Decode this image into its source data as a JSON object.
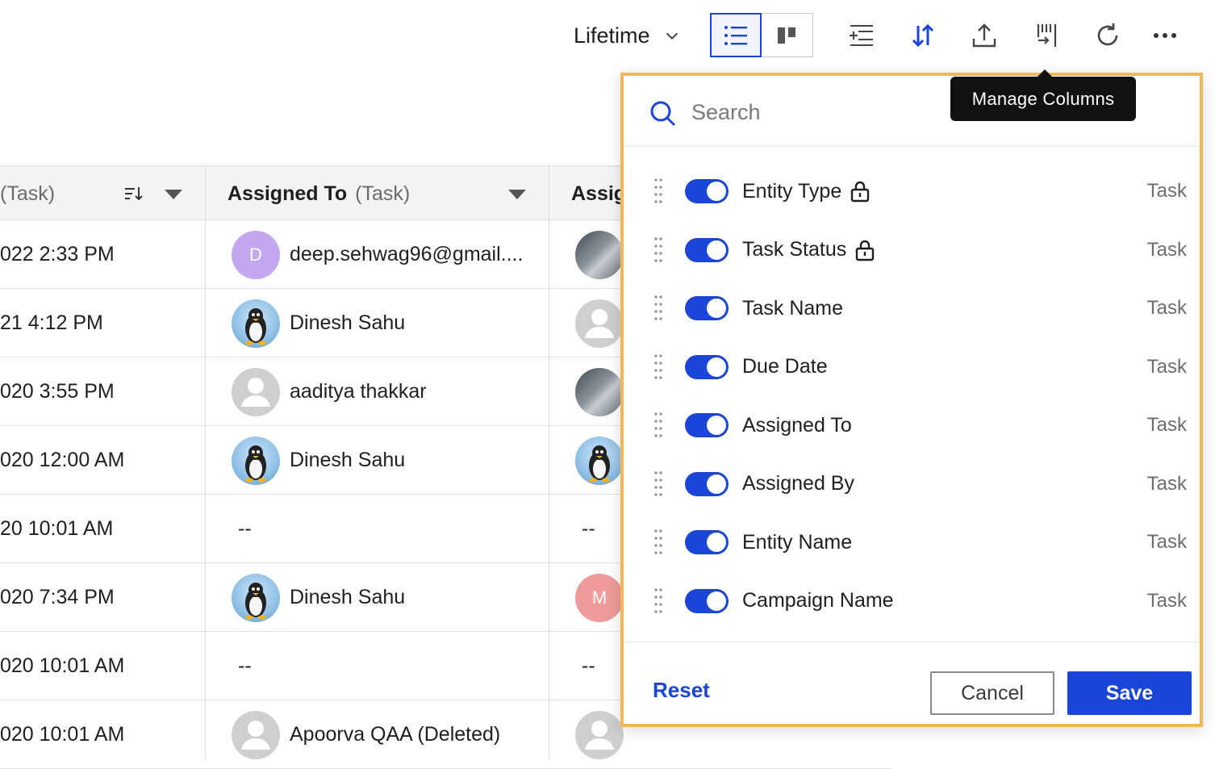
{
  "toolbar": {
    "date_range": "Lifetime",
    "accent": "#1b45d6"
  },
  "table": {
    "headers": [
      {
        "name": "(Task)",
        "sub": ""
      },
      {
        "name": "Assigned To",
        "sub": "(Task)"
      },
      {
        "name": "Assig",
        "sub": ""
      }
    ],
    "rows": [
      {
        "date": "022 2:33 PM",
        "assignee": "deep.sehwag96@gmail....",
        "avatar": "letter",
        "letter": "D",
        "by": "",
        "by_avatar": "photo"
      },
      {
        "date": "21 4:12 PM",
        "assignee": "Dinesh Sahu",
        "avatar": "tux",
        "letter": "",
        "by": "",
        "by_avatar": "default"
      },
      {
        "date": "020 3:55 PM",
        "assignee": "aaditya thakkar",
        "avatar": "default",
        "letter": "",
        "by": "",
        "by_avatar": "photo"
      },
      {
        "date": "020 12:00 AM",
        "assignee": "Dinesh Sahu",
        "avatar": "tux",
        "letter": "",
        "by": "",
        "by_avatar": "tux"
      },
      {
        "date": "20 10:01 AM",
        "assignee": "--",
        "avatar": "none",
        "letter": "",
        "by": "--",
        "by_avatar": "none"
      },
      {
        "date": "020 7:34 PM",
        "assignee": "Dinesh Sahu",
        "avatar": "tux",
        "letter": "",
        "by": "",
        "by_avatar": "letter-m",
        "by_letter": "M"
      },
      {
        "date": "020 10:01 AM",
        "assignee": "--",
        "avatar": "none",
        "letter": "",
        "by": "--",
        "by_avatar": "none"
      },
      {
        "date": "020 10:01 AM",
        "assignee": "Apoorva QAA (Deleted)",
        "avatar": "default",
        "letter": "",
        "by": "",
        "by_avatar": "default"
      }
    ]
  },
  "manage_columns": {
    "tooltip": "Manage Columns",
    "search_placeholder": "Search",
    "columns": [
      {
        "label": "Entity Type",
        "tag": "Task",
        "locked": true,
        "enabled": true
      },
      {
        "label": "Task Status",
        "tag": "Task",
        "locked": true,
        "enabled": true
      },
      {
        "label": "Task Name",
        "tag": "Task",
        "locked": false,
        "enabled": true
      },
      {
        "label": "Due Date",
        "tag": "Task",
        "locked": false,
        "enabled": true
      },
      {
        "label": "Assigned To",
        "tag": "Task",
        "locked": false,
        "enabled": true
      },
      {
        "label": "Assigned By",
        "tag": "Task",
        "locked": false,
        "enabled": true
      },
      {
        "label": "Entity Name",
        "tag": "Task",
        "locked": false,
        "enabled": true
      },
      {
        "label": "Campaign Name",
        "tag": "Task",
        "locked": false,
        "enabled": true
      }
    ],
    "reset_label": "Reset",
    "cancel_label": "Cancel",
    "save_label": "Save"
  }
}
